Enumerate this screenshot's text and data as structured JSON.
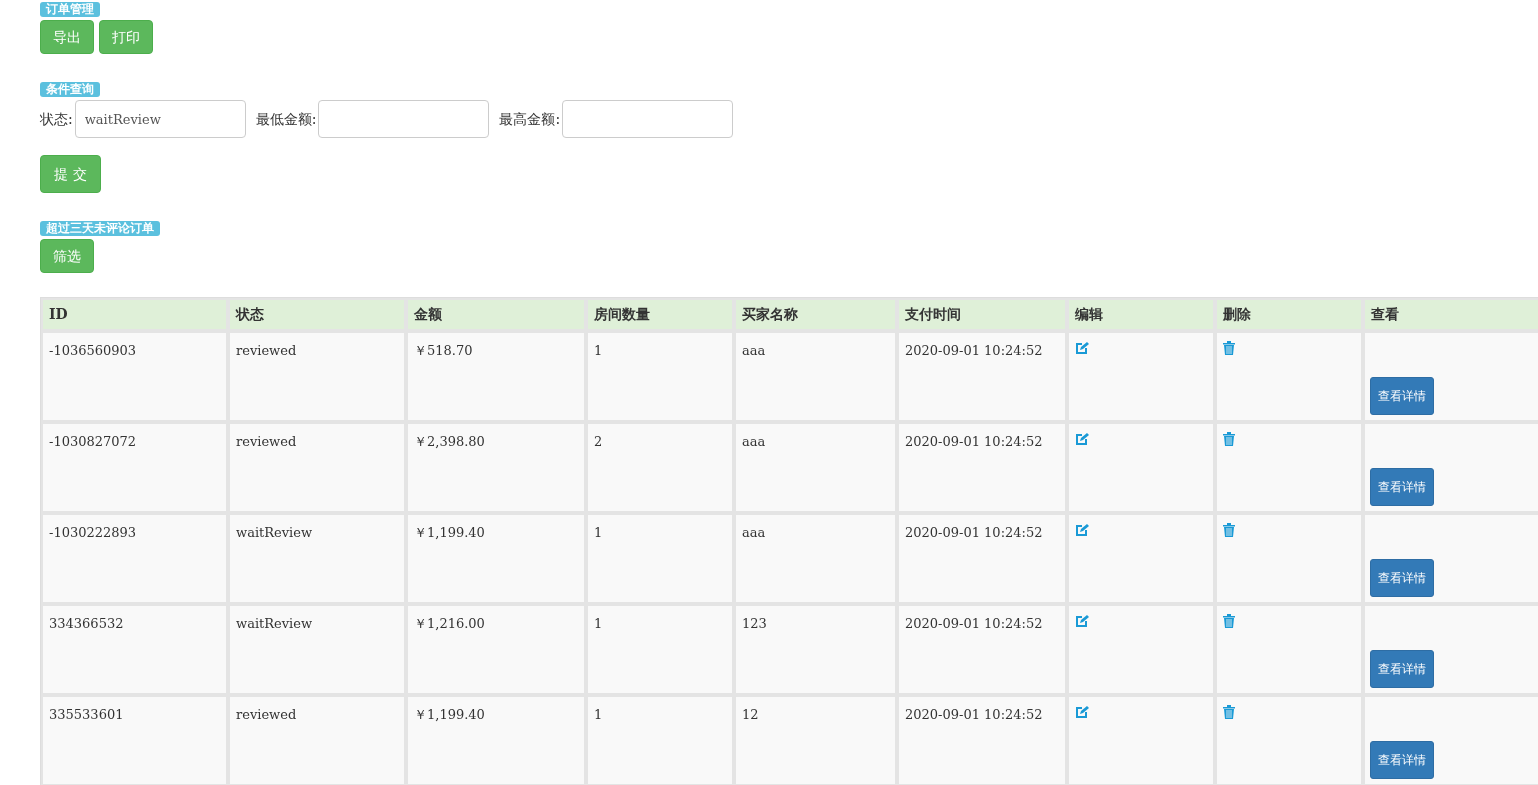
{
  "sections": [
    {
      "label": "订单管理"
    },
    {
      "label": "条件查询"
    },
    {
      "label": "超过三天未评论订单"
    }
  ],
  "order_buttons": [
    "导出",
    "打印"
  ],
  "filters": [
    {
      "label": "状态:",
      "value": "waitReview"
    },
    {
      "label": "最低金额:"
    },
    {
      "label": "最高金额:"
    }
  ],
  "submit_button": "提 交",
  "filter_button": "筛选",
  "table": {
    "columns": [
      "ID",
      "状态",
      "金额",
      "房间数量",
      "买家名称",
      "支付时间",
      "编辑",
      "删除",
      "查看"
    ],
    "rows": [
      {
        "id": "-1036560903",
        "status": "reviewed",
        "amount": "￥518.70",
        "rooms": "1",
        "buyer": "aaa",
        "paid_at": "2020-09-01 10:24:52",
        "detail": "查看详情"
      },
      {
        "id": "-1030827072",
        "status": "reviewed",
        "amount": "￥2,398.80",
        "rooms": "2",
        "buyer": "aaa",
        "paid_at": "2020-09-01 10:24:52",
        "detail": "查看详情"
      },
      {
        "id": "-1030222893",
        "status": "waitReview",
        "amount": "￥1,199.40",
        "rooms": "1",
        "buyer": "aaa",
        "paid_at": "2020-09-01 10:24:52",
        "detail": "查看详情"
      },
      {
        "id": "334366532",
        "status": "waitReview",
        "amount": "￥1,216.00",
        "rooms": "1",
        "buyer": "123",
        "paid_at": "2020-09-01 10:24:52",
        "detail": "查看详情"
      },
      {
        "id": "335533601",
        "status": "reviewed",
        "amount": "￥1,199.40",
        "rooms": "1",
        "buyer": "12",
        "paid_at": "2020-09-01 10:24:52",
        "detail": "查看详情"
      }
    ]
  }
}
